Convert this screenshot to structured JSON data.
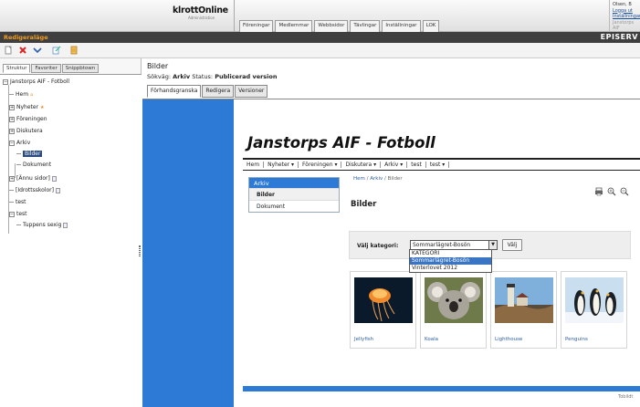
{
  "header": {
    "logo_text": "klrottOnline",
    "logo_subtext": "Administration",
    "tabs": [
      "Föreningar",
      "Medlemmar",
      "Webbsidor",
      "Tävlingar",
      "Inställningar",
      "LOK"
    ],
    "user": {
      "line1": "Olsen, B",
      "line2": "Logga ut",
      "line3": "Inställningar",
      "line4": "Janstorps AIF"
    }
  },
  "editbar": {
    "title": "Redigeraläge",
    "brand": "EPISERV"
  },
  "toolbar": {
    "icons": [
      "new-page-icon",
      "delete-icon",
      "move-icon",
      "edit-icon",
      "bookmark-icon"
    ]
  },
  "left": {
    "tabs": [
      "Struktur",
      "Favoriter",
      "Snippbtown"
    ],
    "tree": {
      "root": "Janstorps AIF - Fotboll",
      "items": [
        "Hem",
        "Nyheter",
        "Föreningen",
        "Diskutera",
        "Arkiv",
        "Bilder",
        "Dokument",
        "[Ännu sidor]",
        "[Idrottsskolor]",
        "test",
        "test",
        "Tuppens sexig"
      ]
    }
  },
  "right": {
    "page_name": "Bilder",
    "status_label": "Sökväg:",
    "status_path": "Arkiv",
    "status_text": "Status:",
    "status_value": "Publicerad version",
    "mode_tabs": [
      "Förhandsgranska",
      "Redigera",
      "Versioner"
    ]
  },
  "site": {
    "title": "Janstorps AIF - Fotboll",
    "nav": [
      "Hem",
      "Nyheter ▾",
      "Föreningen ▾",
      "Diskutera ▾",
      "Arkiv ▾",
      "test",
      "test ▾"
    ],
    "subnav": {
      "head": "Arkiv",
      "items": [
        "Bilder",
        "Dokument"
      ]
    },
    "crumbs": {
      "c1": "Hem",
      "c2": "Arkiv",
      "c3": "Bilder"
    },
    "content_title": "Bilder",
    "category": {
      "label": "Välj kategori:",
      "selected": "Sommarlägret-Bosön",
      "button": "Välj",
      "options": [
        "KATEGORI",
        "Sommarlägret-Bosön",
        "Vinterlovet 2012"
      ]
    },
    "images": [
      {
        "caption": "Jellyfish",
        "icon": "jellyfish-image"
      },
      {
        "caption": "Koala",
        "icon": "koala-image"
      },
      {
        "caption": "Lighthouse",
        "icon": "lighthouse-image"
      },
      {
        "caption": "Penguins",
        "icon": "penguins-image"
      }
    ],
    "footer": "Tobildt"
  },
  "colors": {
    "accent_blue": "#2d7ad6",
    "edit_orange": "#f29b1e",
    "dark_bar": "#3f3f3f"
  }
}
